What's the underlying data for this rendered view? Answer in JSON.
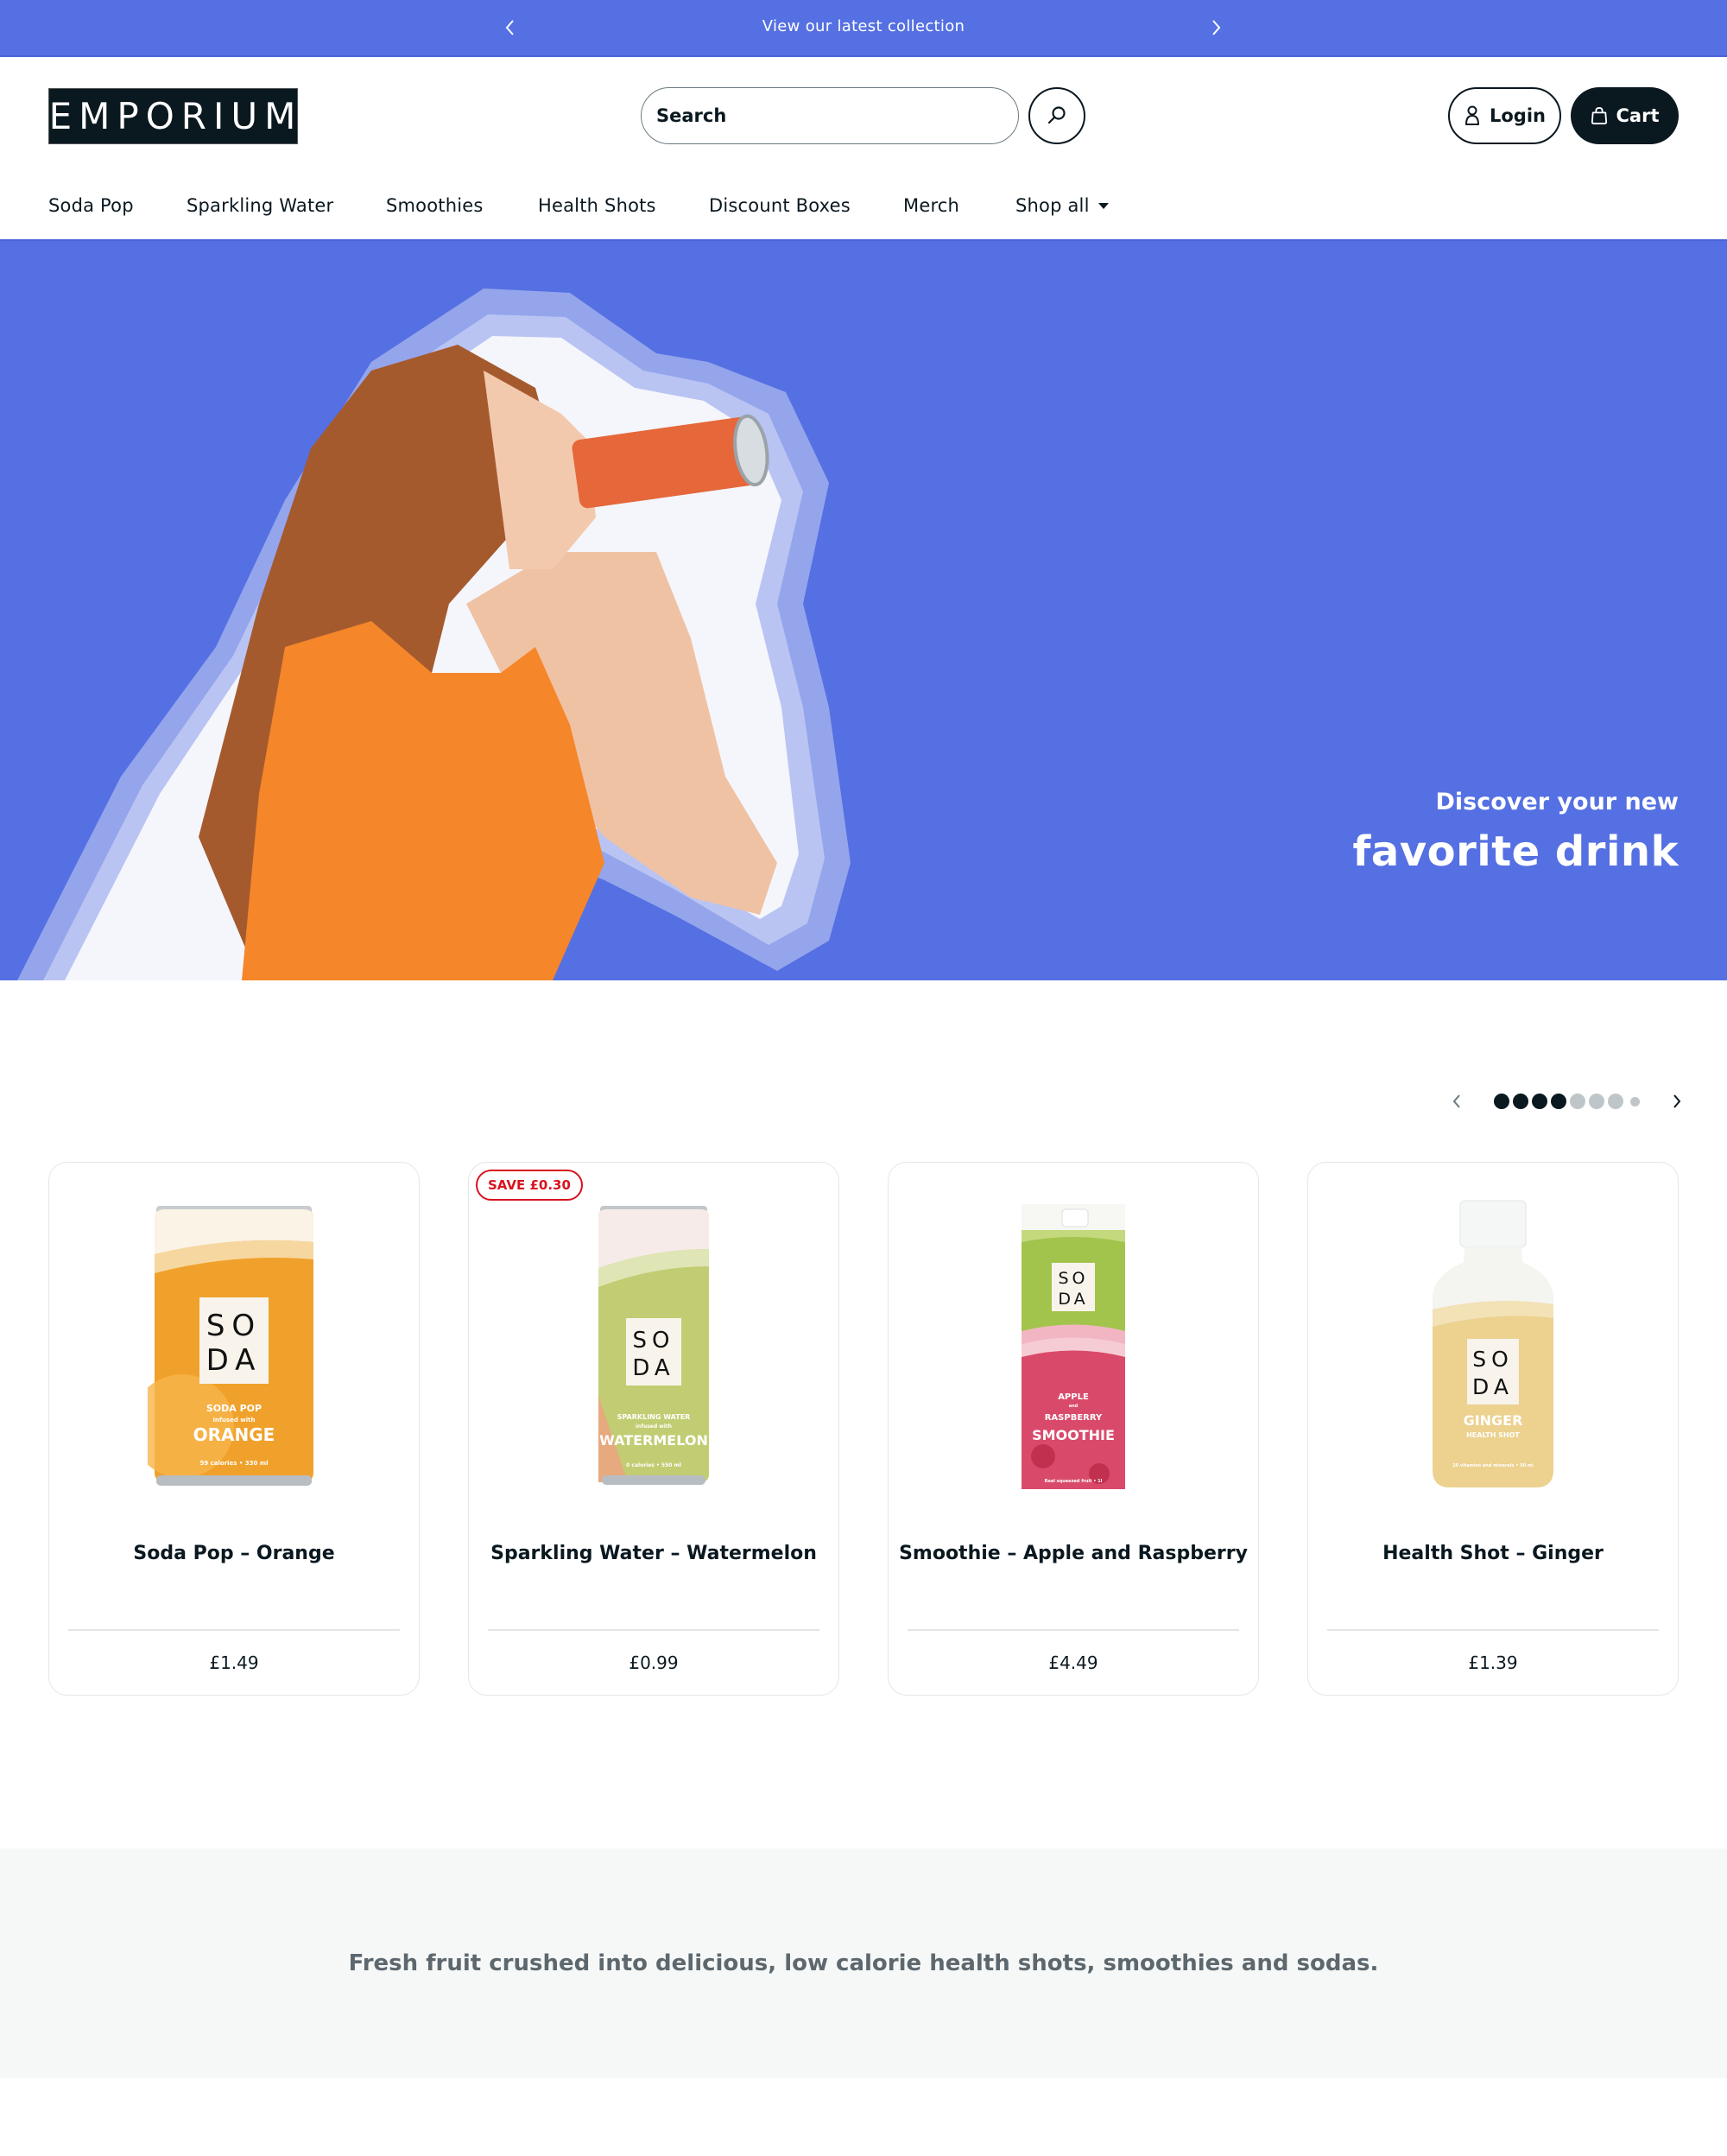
{
  "announcement": {
    "message": "View our latest collection",
    "prev_icon": "chevron-left-icon",
    "next_icon": "chevron-right-icon"
  },
  "header": {
    "logo_text": "EMPORIUM",
    "search": {
      "placeholder": "Search",
      "value": ""
    },
    "search_button_icon": "search-icon",
    "login_label": "Login",
    "cart_label": "Cart"
  },
  "nav": {
    "items": [
      {
        "label": "Soda Pop"
      },
      {
        "label": "Sparkling Water"
      },
      {
        "label": "Smoothies"
      },
      {
        "label": "Health Shots"
      },
      {
        "label": "Discount Boxes"
      },
      {
        "label": "Merch"
      },
      {
        "label": "Shop all",
        "has_dropdown": true
      }
    ]
  },
  "hero": {
    "line1": "Discover your new",
    "line2": "favorite drink",
    "background_color": "#5570e2"
  },
  "carousel": {
    "total_dots": 8,
    "active_dots": 4,
    "prev_disabled": true
  },
  "products": [
    {
      "name": "Soda Pop – Orange",
      "price": "£1.49",
      "badge": null,
      "pack": {
        "brand_top": "SO",
        "brand_bottom": "DA",
        "type": "SODA POP",
        "infused": "infused with",
        "flavor": "ORANGE",
        "info": "59 calories • 330 ml"
      }
    },
    {
      "name": "Sparkling Water – Watermelon",
      "price": "£0.99",
      "badge": "SAVE £0.30",
      "pack": {
        "brand_top": "SO",
        "brand_bottom": "DA",
        "type": "SPARKLING WATER",
        "infused": "infused with",
        "flavor": "WATERMELON",
        "info": "0 calories • 550 ml"
      }
    },
    {
      "name": "Smoothie – Apple and Raspberry",
      "price": "£4.49",
      "badge": null,
      "pack": {
        "brand_top": "SO",
        "brand_bottom": "DA",
        "type": "APPLE",
        "infused": "and",
        "flavor": "RASPBERRY",
        "extra": "SMOOTHIE",
        "info": "Real squeezed fruit • 1l"
      }
    },
    {
      "name": "Health Shot – Ginger",
      "price": "£1.39",
      "badge": null,
      "pack": {
        "brand_top": "SO",
        "brand_bottom": "DA",
        "flavor": "GINGER",
        "type": "HEALTH SHOT",
        "info": "20 vitamins and minerals • 50 ml"
      }
    }
  ],
  "band": {
    "text": "Fresh fruit crushed into delicious, low calorie health shots, smoothies and sodas."
  },
  "colors": {
    "brand_blue": "#5570e2",
    "dark": "#0a1820",
    "sale_red": "#d9121f",
    "band_bg": "#f6f8f8"
  }
}
